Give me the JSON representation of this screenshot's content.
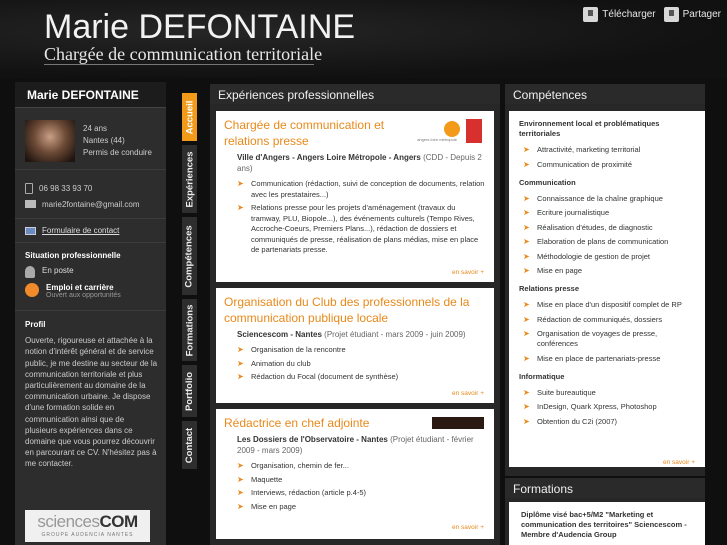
{
  "header": {
    "name": "Marie DEFONTAINE",
    "tagline": "Chargée de communication territoriale",
    "download_label": "Télécharger",
    "share_label": "Partager"
  },
  "sidebar": {
    "title": "Marie DEFONTAINE",
    "age": "24 ans",
    "location": "Nantes (44)",
    "license": "Permis de conduire",
    "phone": "06 98 33 93 70",
    "email": "marie2fontaine@gmail.com",
    "contact_form": "Formulaire de contact",
    "situation_title": "Situation professionnelle",
    "situation_status": "En poste",
    "employment_title": "Emploi et carrière",
    "employment_sub": "Ouvert aux opportunités",
    "profil_title": "Profil",
    "profil_text": "Ouverte, rigoureuse et attachée à la notion d'intérêt général et de service public, je me destine au secteur de la communication territoriale et plus particulièrement au domaine de la communication urbaine. Je dispose d'une formation solide en communication ainsi que de plusieurs expériences dans ce domaine que vous pourrez découvrir en parcourant ce CV. N'hésitez pas à me contacter.",
    "logo_main": "sciences",
    "logo_accent": "COM",
    "logo_sub": "GROUPE AUDENCIA NANTES"
  },
  "tabs": [
    "Accueil",
    "Expériences",
    "Compétences",
    "Formations",
    "Portfolio",
    "Contact"
  ],
  "experiences": {
    "heading": "Expériences professionnelles",
    "more_label": "en savoir +",
    "jobs": [
      {
        "title": "Chargée de communication et relations presse",
        "org": "Ville d'Angers - Angers Loire Métropole - Angers",
        "period": "(CDD - Depuis 2 ans)",
        "items": [
          "Communication (rédaction, suivi de conception de documents, relation avec les prestataires...)",
          "Relations presse pour les projets d'aménagement (travaux du tramway, PLU, Biopole...), des événements culturels (Tempo Rives, Accroche-Coeurs, Premiers Plans...), rédaction de dossiers et communiqués de presse, réalisation de plans médias, mise en place de partenariats presse."
        ],
        "logo_caption": "angers loire métropole"
      },
      {
        "title": "Organisation du Club des professionnels de la communication publique locale",
        "org": "Sciencescom - Nantes",
        "period": "(Projet étudiant - mars 2009 - juin 2009)",
        "items": [
          "Organisation de la rencontre",
          "Animation du club",
          "Rédaction du Focal (document de synthèse)"
        ]
      },
      {
        "title": "Rédactrice en chef adjointe",
        "org": "Les Dossiers de l'Observatoire - Nantes",
        "period": "(Projet étudiant - février 2009 - mars 2009)",
        "items": [
          "Organisation, chemin de fer...",
          "Maquette",
          "Interviews, rédaction (article p.4-5)",
          "Mise en page"
        ]
      }
    ]
  },
  "competences": {
    "heading": "Compétences",
    "more_label": "en savoir +",
    "categories": [
      {
        "name": "Environnement local et problématiques territoriales",
        "items": [
          "Attractivité, marketing territorial",
          "Communication de proximité"
        ]
      },
      {
        "name": "Communication",
        "items": [
          "Connaissance de la chaîne graphique",
          "Ecriture journalistique",
          "Réalisation d'études, de diagnostic",
          "Elaboration de plans de communication",
          "Méthodologie de gestion de projet",
          "Mise en page"
        ]
      },
      {
        "name": "Relations presse",
        "items": [
          "Mise en place d'un dispositif complet de RP",
          "Rédaction de communiqués, dossiers",
          "Organisation de voyages de presse, conférences",
          "Mise en place de partenariats-presse"
        ]
      },
      {
        "name": "Informatique",
        "items": [
          "Suite bureautique",
          "InDesign, Quark Xpress, Photoshop",
          "Obtention du C2i (2007)"
        ]
      }
    ]
  },
  "formations": {
    "heading": "Formations",
    "text": "Diplôme visé bac+5/M2 \"Marketing et communication des territoires\" Sciencescom - Membre d'Audencia Group"
  }
}
